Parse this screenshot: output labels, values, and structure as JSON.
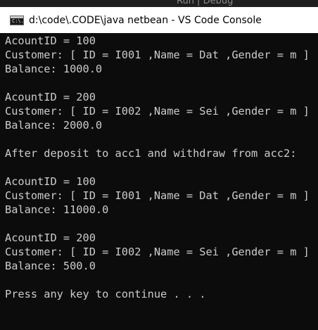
{
  "editor_background": {
    "codelens_text": "Run | Debug"
  },
  "window": {
    "icon_label": "C:\\.",
    "title": "d:\\code\\.CODE\\java netbean - VS Code Console"
  },
  "console": {
    "lines": [
      "AcountID = 100",
      "Customer: [ ID = I001 ,Name = Dat ,Gender = m ]",
      "Balance: 1000.0",
      "",
      "AcountID = 200",
      "Customer: [ ID = I002 ,Name = Sei ,Gender = m ]",
      "Balance: 2000.0",
      "",
      "After deposit to acc1 and withdraw from acc2:",
      "",
      "AcountID = 100",
      "Customer: [ ID = I001 ,Name = Dat ,Gender = m ]",
      "Balance: 11000.0",
      "",
      "AcountID = 200",
      "Customer: [ ID = I002 ,Name = Sei ,Gender = m ]",
      "Balance: 500.0",
      "",
      "Press any key to continue . . ."
    ]
  }
}
